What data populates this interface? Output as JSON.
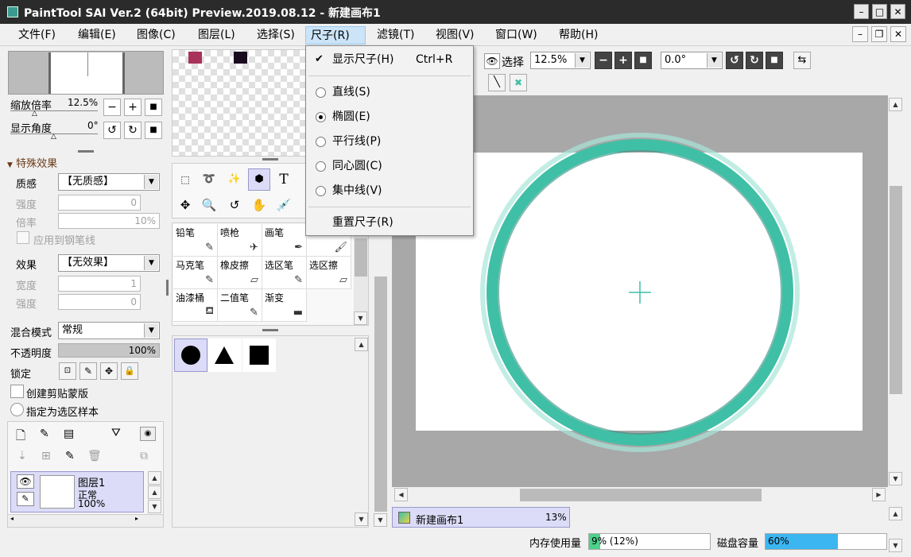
{
  "window": {
    "title": "PaintTool SAI Ver.2 (64bit) Preview.2019.08.12 - 新建画布1",
    "min": "–",
    "max": "□",
    "close": "✕"
  },
  "menu": [
    {
      "label": "文件(F)"
    },
    {
      "label": "编辑(E)"
    },
    {
      "label": "图像(C)"
    },
    {
      "label": "图层(L)"
    },
    {
      "label": "选择(S)"
    },
    {
      "label": "尺子(R)"
    },
    {
      "label": "滤镜(T)"
    },
    {
      "label": "视图(V)"
    },
    {
      "label": "窗口(W)"
    },
    {
      "label": "帮助(H)"
    }
  ],
  "ruler_menu": {
    "show_ruler": {
      "label": "显示尺子(H)",
      "shortcut": "Ctrl+R",
      "checked": true
    },
    "items": [
      {
        "label": "直线(S)",
        "selected": false
      },
      {
        "label": "椭圆(E)",
        "selected": true
      },
      {
        "label": "平行线(P)",
        "selected": false
      },
      {
        "label": "同心圆(C)",
        "selected": false
      },
      {
        "label": "集中线(V)",
        "selected": false
      }
    ],
    "reset": {
      "label": "重置尺子(R)"
    }
  },
  "navigator": {
    "zoom_label": "缩放倍率",
    "zoom_value": "12.5%",
    "angle_label": "显示角度",
    "angle_value": "0°"
  },
  "effects": {
    "header": "特殊效果",
    "texture_label": "质感",
    "texture_value": "【无质感】",
    "strength_label": "强度",
    "strength_value": "0",
    "scale_label": "倍率",
    "scale_value": "10%",
    "apply_pen": "应用到钢笔线",
    "effect_label": "效果",
    "effect_value": "【无效果】",
    "width_label": "宽度",
    "width_value": "1",
    "strength2_label": "强度",
    "strength2_value": "0"
  },
  "layer_props": {
    "blend_label": "混合模式",
    "blend_value": "常规",
    "opacity_label": "不透明度",
    "opacity_value": "100%",
    "opacity_fraction": 1.0,
    "lock_label": "锁定",
    "clip_label": "创建剪贴蒙版",
    "selection_source_label": "指定为选区样本"
  },
  "layers": [
    {
      "name": "图层1",
      "mode": "正常",
      "opacity": "100%"
    }
  ],
  "swatches": [
    {
      "color": "#a8325a"
    },
    {
      "color": "#1a0a1e"
    }
  ],
  "brushes": [
    {
      "name": "铅笔",
      "icon": "✎"
    },
    {
      "name": "喷枪",
      "icon": "✈"
    },
    {
      "name": "画笔",
      "icon": "✒"
    },
    {
      "name": "",
      "icon": "🖌"
    },
    {
      "name": "马克笔",
      "icon": "✎"
    },
    {
      "name": "橡皮擦",
      "icon": "▱"
    },
    {
      "name": "选区笔",
      "icon": "✎"
    },
    {
      "name": "选区擦",
      "icon": "▱"
    },
    {
      "name": "油漆桶",
      "icon": "⛾"
    },
    {
      "name": "二值笔",
      "icon": "✎"
    },
    {
      "name": "渐变",
      "icon": "▬"
    }
  ],
  "toolbar": {
    "view_label": "选择",
    "zoom_value": "12.5%",
    "angle_value": "0.0°"
  },
  "canvas_tab": {
    "name": "新建画布1",
    "zoom": "13%"
  },
  "status": {
    "memory_label": "内存使用量",
    "memory_value": "9% (12%)",
    "memory_fraction": 0.09,
    "disk_label": "磁盘容量",
    "disk_value": "60%",
    "disk_fraction": 0.6
  },
  "colors": {
    "ruler": "#3fbfa6",
    "ruler_dark": "#2a8c7c",
    "ruler_glow": "#a6e6d8",
    "accent": "#cce4f7"
  }
}
